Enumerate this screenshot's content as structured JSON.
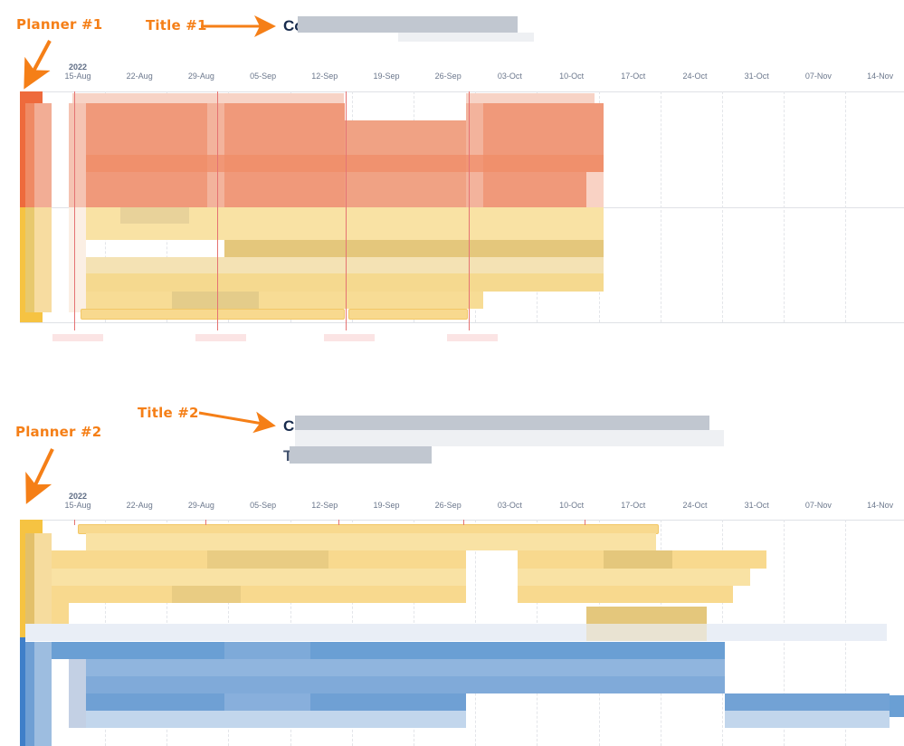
{
  "annotations": {
    "planner1": "Planner #1",
    "title1": "Title #1",
    "planner2": "Planner #2",
    "title2": "Title #2",
    "color": "#f57f17"
  },
  "planner1": {
    "title_visible_prefix": "Co",
    "title_redacted": true,
    "year": "2022",
    "ticks": [
      "15-Aug",
      "22-Aug",
      "29-Aug",
      "05-Sep",
      "12-Sep",
      "19-Sep",
      "26-Sep",
      "03-Oct",
      "10-Oct",
      "17-Oct",
      "24-Oct",
      "31-Oct",
      "07-Nov",
      "14-Nov"
    ],
    "sprints": [
      "Sprint (redacted)",
      "Sprint (redacted)",
      "Sprint (redacted)",
      "Sprint (redacted)"
    ],
    "groups": [
      {
        "name": "orange-group",
        "color": "#ee6a3c",
        "fill": "#f0997a"
      },
      {
        "name": "yellow-group",
        "color": "#f6c342",
        "fill": "#f9dc93"
      }
    ]
  },
  "planner2": {
    "title_visible_prefix": "C",
    "subtitle_visible_prefix": "T",
    "title_redacted": true,
    "year": "2022",
    "ticks": [
      "15-Aug",
      "22-Aug",
      "29-Aug",
      "05-Sep",
      "12-Sep",
      "19-Sep",
      "26-Sep",
      "03-Oct",
      "10-Oct",
      "17-Oct",
      "24-Oct",
      "31-Oct",
      "07-Nov",
      "14-Nov"
    ],
    "groups": [
      {
        "name": "yellow-group",
        "color": "#f6c342",
        "fill": "#f9dc93"
      },
      {
        "name": "blue-group",
        "color": "#3f7fc9",
        "fill": "#6b9fd4"
      }
    ]
  }
}
